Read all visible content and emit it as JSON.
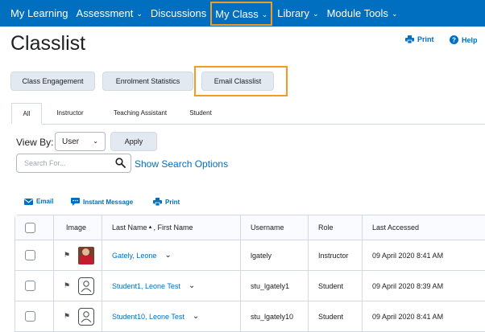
{
  "nav": {
    "items": [
      {
        "label": "My Learning",
        "chevron": false
      },
      {
        "label": "Assessment",
        "chevron": true
      },
      {
        "label": "Discussions",
        "chevron": false
      },
      {
        "label": "My Class",
        "chevron": true
      },
      {
        "label": "Library",
        "chevron": true
      },
      {
        "label": "Module Tools",
        "chevron": true
      }
    ]
  },
  "header": {
    "title": "Classlist",
    "print_label": "Print",
    "help_label": "Help"
  },
  "buttons": {
    "engagement": "Class Engagement",
    "enrolment": "Enrolment Statistics",
    "email_classlist": "Email Classlist"
  },
  "tabs": [
    "All",
    "Instructor",
    "Teaching Assistant",
    "Student"
  ],
  "filters": {
    "view_by_label": "View By:",
    "view_by_value": "User",
    "apply_label": "Apply",
    "search_placeholder": "Search For...",
    "search_options_label": "Show Search Options"
  },
  "actions": {
    "email": "Email",
    "instant_message": "Instant Message",
    "print": "Print"
  },
  "table": {
    "columns": {
      "image": "Image",
      "name": "Last Name",
      "name_suffix": ", First Name",
      "username": "Username",
      "role": "Role",
      "last_accessed": "Last Accessed"
    },
    "rows": [
      {
        "name": "Gately, Leone",
        "username": "lgately",
        "role": "Instructor",
        "last_accessed": "09 April 2020 8:41 AM"
      },
      {
        "name": "Student1, Leone Test",
        "username": "stu_lgately1",
        "role": "Student",
        "last_accessed": "09 April 2020 8:39 AM"
      },
      {
        "name": "Student10, Leone Test",
        "username": "stu_lgately10",
        "role": "Student",
        "last_accessed": "09 April 2020 8:41 AM"
      }
    ]
  },
  "colors": {
    "nav_bg": "#006fbf",
    "link": "#006fbf",
    "highlight": "#f59a23"
  }
}
